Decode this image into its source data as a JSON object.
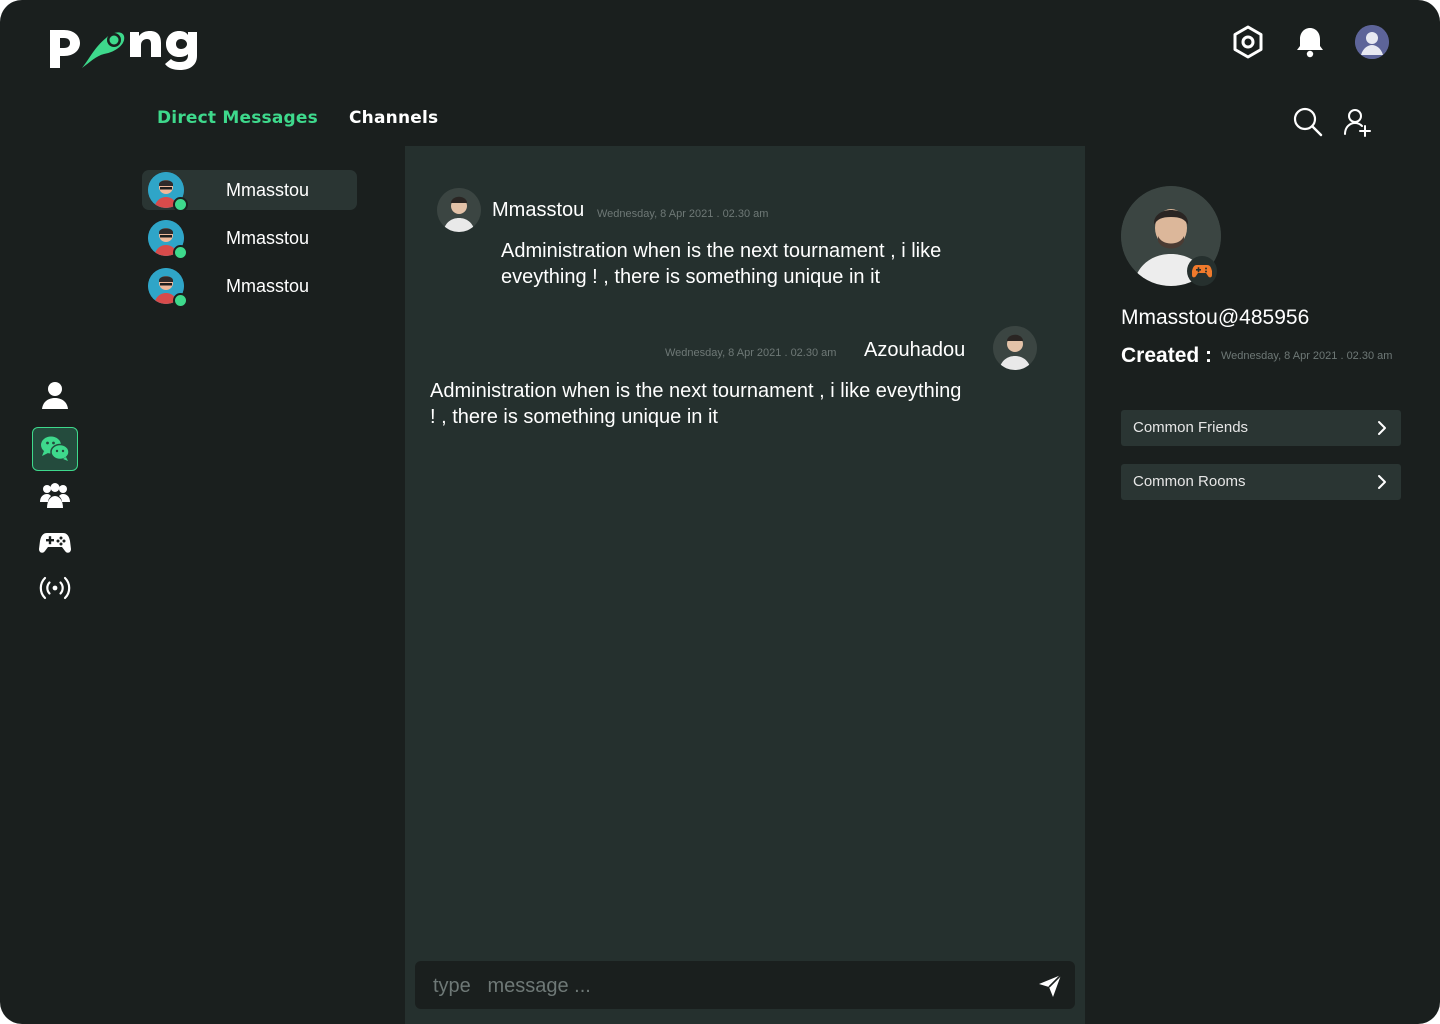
{
  "app": {
    "logo_text": "pong",
    "accent_color": "#3ed98c",
    "background": "#1a1f1e"
  },
  "header": {
    "icons": [
      "settings-icon",
      "bell-icon",
      "user-avatar"
    ]
  },
  "tabs": [
    {
      "label": "Direct Messages",
      "active": true
    },
    {
      "label": "Channels",
      "active": false
    }
  ],
  "toolbar_icons": [
    "search-icon",
    "add-user-icon"
  ],
  "rail": [
    {
      "icon": "user-icon",
      "active": false
    },
    {
      "icon": "chat-icon",
      "active": true
    },
    {
      "icon": "group-icon",
      "active": false
    },
    {
      "icon": "gamepad-icon",
      "active": false
    },
    {
      "icon": "broadcast-icon",
      "active": false
    }
  ],
  "conversations": [
    {
      "name": "Mmasstou",
      "active": true,
      "online": true
    },
    {
      "name": "Mmasstou",
      "active": false,
      "online": true
    },
    {
      "name": "Mmasstou",
      "active": false,
      "online": true
    }
  ],
  "messages": [
    {
      "sender": "Mmasstou",
      "time": "Wednesday, 8 Apr 2021 . 02.30 am",
      "line1": "Administration when is the next tournament , i like",
      "line2": "eveything ! , there is something  unique in it"
    },
    {
      "sender": "Azouhadou",
      "time": "Wednesday, 8 Apr 2021 . 02.30 am",
      "line1": "Administration when is the next tournament , i like eveything",
      "line2": "! , there is something  unique in it"
    }
  ],
  "composer": {
    "placeholder": "type   message ..."
  },
  "profile": {
    "username": "Mmasstou@485956",
    "created_label": "Created :",
    "created_time": "Wednesday, 8 Apr 2021 . 02.30 am",
    "buttons": [
      "Common Friends",
      "Common Rooms"
    ]
  }
}
